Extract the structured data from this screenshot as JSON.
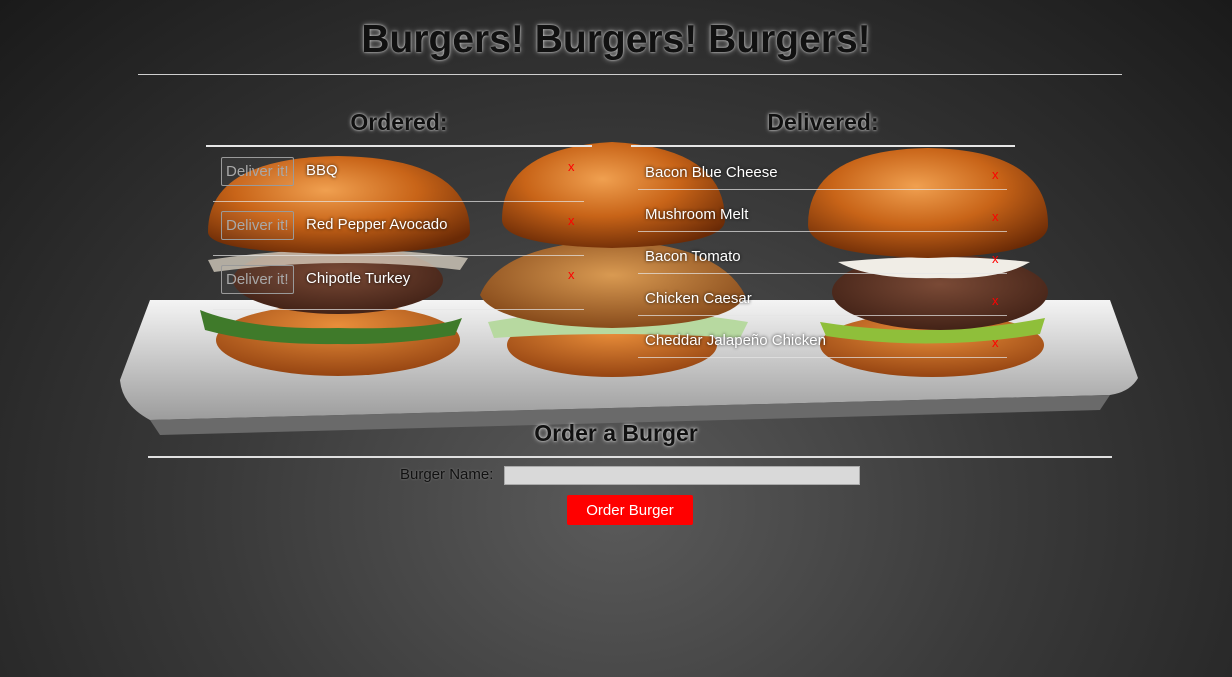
{
  "page": {
    "title": "Burgers! Burgers! Burgers!"
  },
  "ordered": {
    "heading": "Ordered:",
    "deliver_label": "Deliver it!",
    "remove_label": "x",
    "items": [
      {
        "name": "BBQ"
      },
      {
        "name": "Red Pepper Avocado"
      },
      {
        "name": "Chipotle Turkey"
      }
    ]
  },
  "delivered": {
    "heading": "Delivered:",
    "remove_label": "x",
    "items": [
      {
        "name": "Bacon Blue Cheese"
      },
      {
        "name": "Mushroom Melt"
      },
      {
        "name": "Bacon Tomato"
      },
      {
        "name": "Chicken Caesar"
      },
      {
        "name": "Cheddar Jalapeño Chicken"
      }
    ]
  },
  "form": {
    "heading": "Order a Burger",
    "label": "Burger Name:",
    "value": "",
    "placeholder": "",
    "submit_label": "Order Burger"
  },
  "colors": {
    "accent": "#ff0000",
    "heading_text": "#111111",
    "rule": "#e6e6e6"
  },
  "background": {
    "description_icon": "burgers-on-plate-photo"
  }
}
